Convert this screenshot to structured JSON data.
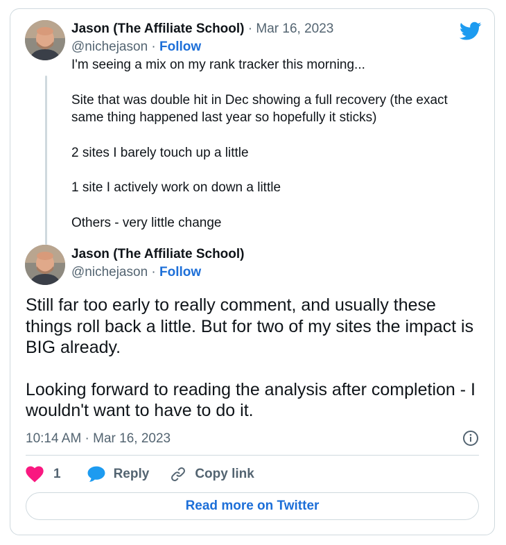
{
  "quoted_tweet": {
    "author_name": "Jason (The Affiliate School)",
    "separator": "·",
    "date": "Mar 16, 2023",
    "handle": "@nichejason",
    "handle_separator": "·",
    "follow_label": "Follow",
    "paragraphs": [
      "I'm seeing a mix on my rank tracker this morning...",
      "Site that was double hit in Dec showing a full recovery (the exact same thing happened last year so hopefully it sticks)",
      "2 sites I barely touch up a little",
      "1 site I actively work on down a little",
      "Others - very little change"
    ]
  },
  "main_tweet": {
    "author_name": "Jason (The Affiliate School)",
    "handle": "@nichejason",
    "handle_separator": "·",
    "follow_label": "Follow",
    "paragraphs": [
      "Still far too early to really comment, and usually these things roll back a little. But for two of my sites the impact is BIG already.",
      "Looking forward to reading the analysis after completion - I wouldn't want to have to do it."
    ],
    "timestamp": "10:14 AM · Mar 16, 2023"
  },
  "actions": {
    "like_count": "1",
    "reply_label": "Reply",
    "copy_link_label": "Copy link"
  },
  "read_more_label": "Read more on Twitter",
  "icons": {
    "brand": "twitter-bird-icon",
    "like": "heart-icon",
    "reply": "speech-bubble-icon",
    "copy": "link-icon",
    "info": "info-icon"
  },
  "colors": {
    "twitter_blue": "#1d9bf0",
    "link_blue": "#1d6fd8",
    "like_pink": "#f91880",
    "muted_text": "#536471",
    "border": "#cfd9de"
  }
}
